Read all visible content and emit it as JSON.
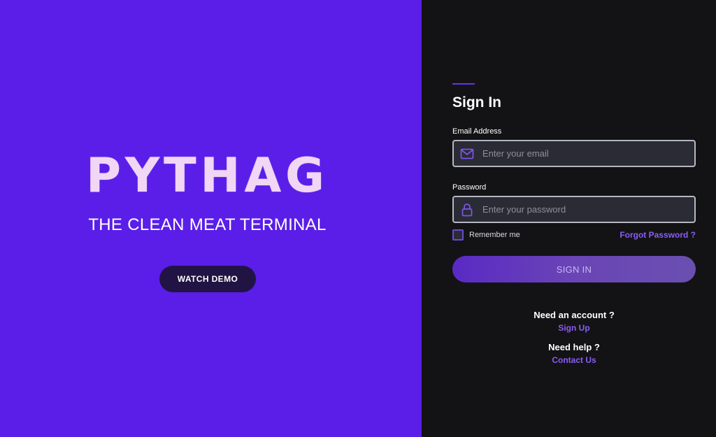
{
  "hero": {
    "logo": "PYTHAG",
    "tagline": "THE CLEAN MEAT TERMINAL",
    "demo_button": "WATCH DEMO"
  },
  "signin": {
    "title": "Sign In",
    "email": {
      "label": "Email Address",
      "placeholder": "Enter your email",
      "icon": "mail-icon"
    },
    "password": {
      "label": "Password",
      "placeholder": "Enter your password",
      "icon": "lock-icon"
    },
    "remember_label": "Remember me",
    "remember_checked": false,
    "forgot_label": "Forgot Password ?",
    "submit_label": "SIGN IN",
    "need_account": "Need an account ?",
    "signup_link": "Sign Up",
    "need_help": "Need help ?",
    "contact_link": "Contact Us"
  },
  "colors": {
    "hero_bg": "#5a1ee8",
    "panel_bg": "#131316",
    "accent": "#8a5cf5",
    "input_bg": "#2a2b35"
  }
}
